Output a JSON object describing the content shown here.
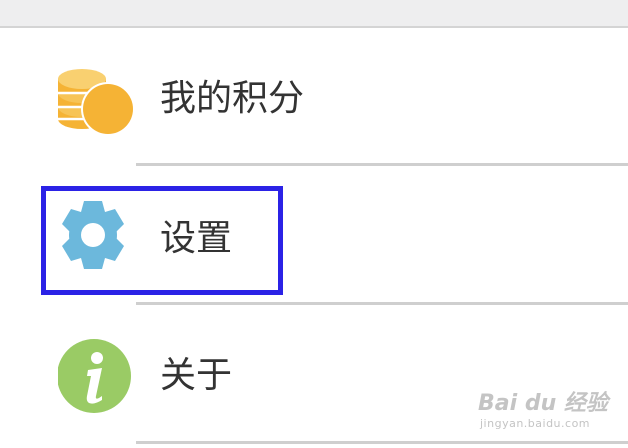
{
  "menu": {
    "items": [
      {
        "label": "我的积分",
        "icon": "coins-icon",
        "icon_color": "#F5B335"
      },
      {
        "label": "设置",
        "icon": "gear-icon",
        "icon_color": "#6CB8DC"
      },
      {
        "label": "关于",
        "icon": "info-icon",
        "icon_color": "#9ACB65"
      }
    ]
  },
  "highlight": {
    "target": "设置",
    "color": "#2B22E6"
  },
  "watermark": {
    "brand": "Bai du 经验",
    "url": "jingyan.baidu.com"
  }
}
